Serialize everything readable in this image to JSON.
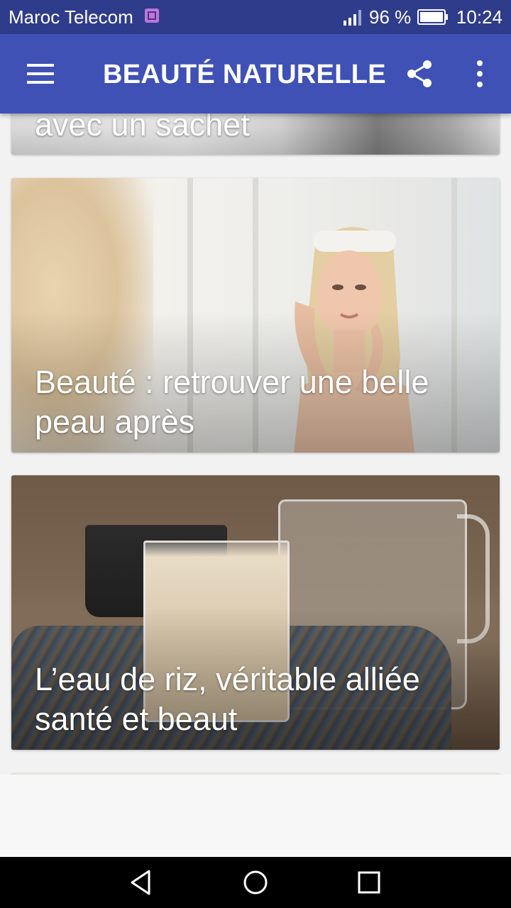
{
  "status_bar": {
    "carrier": "Maroc Telecom",
    "battery": "96 %",
    "time": "10:24",
    "icons": [
      "sim-icon",
      "signal-icon",
      "battery-icon"
    ]
  },
  "app_bar": {
    "title": "BEAUTÉ NATURELLE",
    "background": "#3f51b5",
    "icons": [
      "menu-icon",
      "share-icon",
      "more-vert-icon"
    ]
  },
  "articles": [
    {
      "title": "avec un sachet"
    },
    {
      "title": "Beauté : retrouver une belle peau après"
    },
    {
      "title": "L’eau de riz, véritable alliée santé et beaut"
    }
  ],
  "nav_bar": {
    "icons": [
      "back-icon",
      "home-icon",
      "recent-apps-icon"
    ]
  },
  "colors": {
    "status_bar": "#2f3c8c",
    "app_bar": "#3f51b5",
    "page_background": "#f2f2f2",
    "nav_bar": "#000000"
  }
}
